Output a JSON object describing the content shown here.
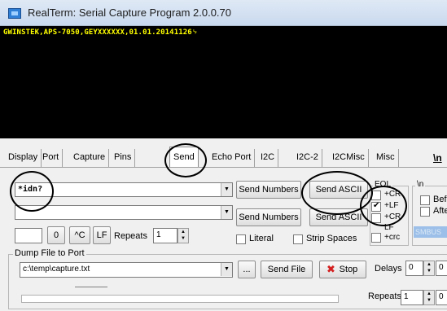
{
  "window": {
    "title": "RealTerm: Serial Capture Program 2.0.0.70"
  },
  "terminal": {
    "line1": "GWINSTEK,APS-7050,GEYXXXXXX,01.01.20141126␊"
  },
  "tabs": [
    {
      "label": "Display"
    },
    {
      "label": "Port"
    },
    {
      "label": "Capture"
    },
    {
      "label": "Pins"
    },
    {
      "label": "Send"
    },
    {
      "label": "Echo Port"
    },
    {
      "label": "I2C"
    },
    {
      "label": "I2C-2"
    },
    {
      "label": "I2CMisc"
    },
    {
      "label": "Misc"
    },
    {
      "label": "\\n"
    }
  ],
  "send": {
    "combo1_value": "*idn?",
    "combo2_value": "",
    "send_numbers_1": "Send Numbers",
    "send_ascii_1": "Send ASCII",
    "send_numbers_2": "Send Numbers",
    "send_ascii_2": "Send ASCII",
    "char_input": "",
    "zero_button": "0",
    "ctrl_c_button": "^C",
    "lf_button": "LF",
    "repeats_label": "Repeats",
    "repeats_value": "1",
    "literal_label": "Literal",
    "strip_spaces_label": "Strip Spaces"
  },
  "eol": {
    "title": "EOL",
    "items": [
      {
        "label": "+CR",
        "checked": false
      },
      {
        "label": "+LF",
        "checked": true
      },
      {
        "label": "+CR",
        "checked": false
      },
      {
        "label": "LF",
        "checked": false
      },
      {
        "label": "+crc",
        "checked": false
      }
    ]
  },
  "n_group": {
    "title": "\\n",
    "before_label": "Bef",
    "after_label": "Afte",
    "smbus_label": "SMBUS"
  },
  "dump": {
    "title": "Dump File to Port",
    "file_path": "c:\\temp\\capture.txt",
    "browse_button": "...",
    "send_file_button": "Send File",
    "stop_button": "Stop",
    "delays_label": "Delays",
    "delays_value": "0",
    "delays_value2": "0",
    "repeats_label": "Repeats",
    "repeats_value": "1",
    "repeats_value2": "0"
  },
  "colors": {
    "terminal_bg": "#000000",
    "terminal_text": "#ffff00",
    "stop_icon": "#d42020"
  }
}
